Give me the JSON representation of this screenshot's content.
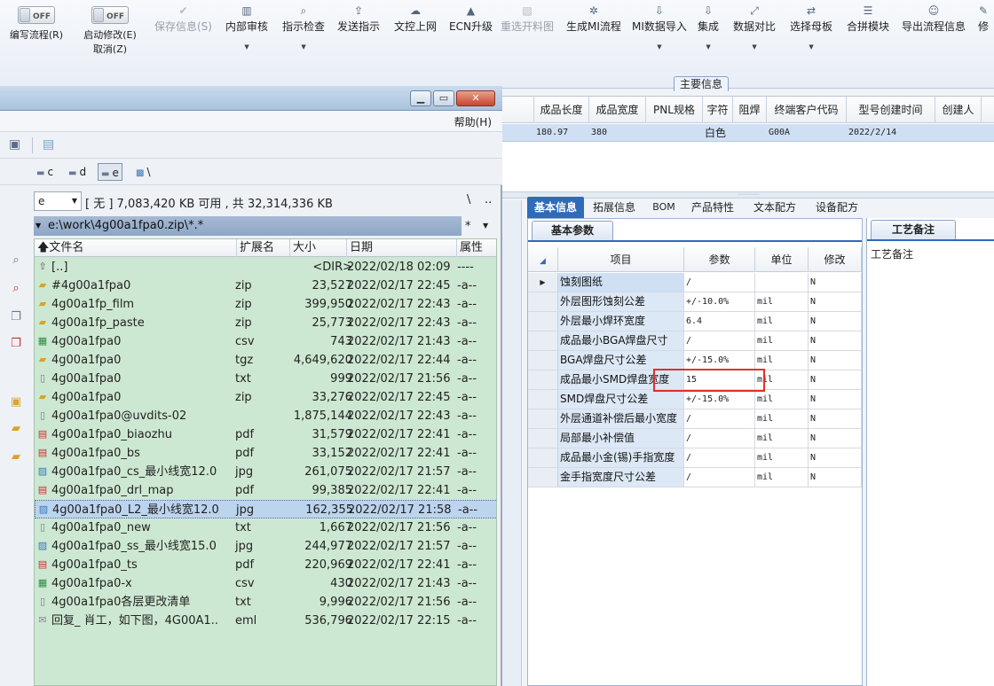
{
  "toolbar": {
    "toggle1": {
      "state": "OFF",
      "label": "编写流程(R)"
    },
    "toggle2": {
      "state": "OFF",
      "label1": "启动修改(E)",
      "label2": "取消(Z)"
    },
    "buttons": [
      {
        "label": "保存信息(S)",
        "icon": "check-icon",
        "disabled": true
      },
      {
        "label": "内部审核",
        "icon": "print-icon",
        "disabled": false,
        "dropdown": true
      },
      {
        "label": "指示检查",
        "icon": "search-icon",
        "disabled": false,
        "dropdown": true
      },
      {
        "label": "发送指示",
        "icon": "upload-icon",
        "disabled": false
      },
      {
        "label": "文控上网",
        "icon": "cloud-icon",
        "disabled": false
      },
      {
        "label": "ECN升级",
        "icon": "ecn-icon",
        "disabled": false
      },
      {
        "label": "重选开料图",
        "icon": "image-icon",
        "disabled": true
      },
      {
        "label": "生成MI流程",
        "icon": "gear-icon",
        "disabled": false
      },
      {
        "label": "MI数据导入",
        "icon": "download-icon",
        "disabled": false,
        "dropdown": true
      },
      {
        "label": "集成",
        "icon": "download-icon",
        "disabled": false,
        "dropdown": true
      },
      {
        "label": "数据对比",
        "icon": "compare-icon",
        "disabled": false,
        "dropdown": true
      },
      {
        "label": "选择母板",
        "icon": "shuffle-icon",
        "disabled": false,
        "dropdown": true
      },
      {
        "label": "合拼模块",
        "icon": "list-icon",
        "disabled": false
      },
      {
        "label": "导出流程信息",
        "icon": "smile-icon",
        "disabled": false
      },
      {
        "label": "修",
        "icon": "edit-icon",
        "disabled": false
      }
    ]
  },
  "main_info_tab": "主要信息",
  "top_grid": {
    "columns": [
      "成品长度",
      "成品宽度",
      "PNL规格",
      "字符",
      "阻焊",
      "终端客户代码",
      "型号创建时间",
      "创建人"
    ],
    "row": [
      "180.97",
      "380",
      "",
      "白色",
      "",
      "G00A",
      "2022/2/14",
      ""
    ]
  },
  "tabs": [
    "基本信息",
    "拓展信息",
    "BOM",
    "产品特性",
    "文本配方",
    "设备配方"
  ],
  "param_panel": {
    "tab": "基本参数",
    "columns": [
      "项目",
      "参数",
      "单位",
      "修改"
    ],
    "rows": [
      {
        "item": "蚀刻图纸",
        "param": "/",
        "unit": "",
        "mod": "N"
      },
      {
        "item": "外层图形蚀刻公差",
        "param": "+/-10.0%",
        "unit": "mil",
        "mod": "N"
      },
      {
        "item": "外层最小焊环宽度",
        "param": "6.4",
        "unit": "mil",
        "mod": "N"
      },
      {
        "item": "成品最小BGA焊盘尺寸",
        "param": "/",
        "unit": "mil",
        "mod": "N"
      },
      {
        "item": "BGA焊盘尺寸公差",
        "param": "+/-15.0%",
        "unit": "mil",
        "mod": "N"
      },
      {
        "item": "成品最小SMD焊盘宽度",
        "param": "15",
        "unit": "mil",
        "mod": "N"
      },
      {
        "item": "SMD焊盘尺寸公差",
        "param": "+/-15.0%",
        "unit": "mil",
        "mod": "N"
      },
      {
        "item": "外层通道补偿后最小宽度",
        "param": "/",
        "unit": "mil",
        "mod": "N"
      },
      {
        "item": "局部最小补偿值",
        "param": "/",
        "unit": "mil",
        "mod": "N"
      },
      {
        "item": "成品最小金(锡)手指宽度",
        "param": "/",
        "unit": "mil",
        "mod": "N"
      },
      {
        "item": "金手指宽度尺寸公差",
        "param": "/",
        "unit": "mil",
        "mod": "N"
      }
    ]
  },
  "notes_panel": {
    "tab": "工艺备注",
    "label": "工艺备注"
  },
  "file_manager": {
    "menu_help": "帮助(H)",
    "drives": [
      "c",
      "d",
      "e",
      "\\"
    ],
    "drive_select": "e",
    "free_space": "[ 无 ]  7,083,420 KB 可用 , 共 32,314,336 KB",
    "nav_back": "\\",
    "nav_up": "..",
    "path": "e:\\work\\4g00a1fpa0.zip\\*.*",
    "path_star": "*",
    "columns": {
      "name": "文件名",
      "ext": "扩展名",
      "size": "大小",
      "date": "日期",
      "attr": "属性"
    },
    "files": [
      {
        "icon": "up",
        "name": "[..]",
        "ext": "",
        "size": "<DIR>",
        "date": "2022/02/18 02:09",
        "attr": "----"
      },
      {
        "icon": "zip",
        "name": "#4g00a1fpa0",
        "ext": "zip",
        "size": "23,527",
        "date": "2022/02/17 22:45",
        "attr": "-a--"
      },
      {
        "icon": "zip",
        "name": "4g00a1fp_film",
        "ext": "zip",
        "size": "399,950",
        "date": "2022/02/17 22:43",
        "attr": "-a--"
      },
      {
        "icon": "zip",
        "name": "4g00a1fp_paste",
        "ext": "zip",
        "size": "25,773",
        "date": "2022/02/17 22:43",
        "attr": "-a--"
      },
      {
        "icon": "csv",
        "name": "4g00a1fpa0",
        "ext": "csv",
        "size": "743",
        "date": "2022/02/17 21:43",
        "attr": "-a--"
      },
      {
        "icon": "zip",
        "name": "4g00a1fpa0",
        "ext": "tgz",
        "size": "4,649,620",
        "date": "2022/02/17 22:44",
        "attr": "-a--"
      },
      {
        "icon": "txt",
        "name": "4g00a1fpa0",
        "ext": "txt",
        "size": "999",
        "date": "2022/02/17 21:56",
        "attr": "-a--"
      },
      {
        "icon": "zip",
        "name": "4g00a1fpa0",
        "ext": "zip",
        "size": "33,276",
        "date": "2022/02/17 22:45",
        "attr": "-a--"
      },
      {
        "icon": "txt",
        "name": "4g00a1fpa0@uvdits-02",
        "ext": "",
        "size": "1,875,144",
        "date": "2022/02/17 22:43",
        "attr": "-a--"
      },
      {
        "icon": "pdf",
        "name": "4g00a1fpa0_biaozhu",
        "ext": "pdf",
        "size": "31,579",
        "date": "2022/02/17 22:41",
        "attr": "-a--"
      },
      {
        "icon": "pdf",
        "name": "4g00a1fpa0_bs",
        "ext": "pdf",
        "size": "33,152",
        "date": "2022/02/17 22:41",
        "attr": "-a--"
      },
      {
        "icon": "img",
        "name": "4g00a1fpa0_cs_最小线宽12.0",
        "ext": "jpg",
        "size": "261,075",
        "date": "2022/02/17 21:57",
        "attr": "-a--"
      },
      {
        "icon": "pdf",
        "name": "4g00a1fpa0_drl_map",
        "ext": "pdf",
        "size": "99,385",
        "date": "2022/02/17 22:41",
        "attr": "-a--"
      },
      {
        "icon": "img",
        "name": "4g00a1fpa0_L2_最小线宽12.0",
        "ext": "jpg",
        "size": "162,355",
        "date": "2022/02/17 21:58",
        "attr": "-a--",
        "selected": true
      },
      {
        "icon": "txt",
        "name": "4g00a1fpa0_new",
        "ext": "txt",
        "size": "1,667",
        "date": "2022/02/17 21:56",
        "attr": "-a--"
      },
      {
        "icon": "img",
        "name": "4g00a1fpa0_ss_最小线宽15.0",
        "ext": "jpg",
        "size": "244,977",
        "date": "2022/02/17 21:57",
        "attr": "-a--"
      },
      {
        "icon": "pdf",
        "name": "4g00a1fpa0_ts",
        "ext": "pdf",
        "size": "220,969",
        "date": "2022/02/17 22:41",
        "attr": "-a--"
      },
      {
        "icon": "csv",
        "name": "4g00a1fpa0-x",
        "ext": "csv",
        "size": "430",
        "date": "2022/02/17 21:43",
        "attr": "-a--"
      },
      {
        "icon": "txt",
        "name": "4g00a1fpa0各层更改清单",
        "ext": "txt",
        "size": "9,996",
        "date": "2022/02/17 21:56",
        "attr": "-a--"
      },
      {
        "icon": "eml",
        "name": "回复_ 肖工，如下图，4G00A1..",
        "ext": "eml",
        "size": "536,796",
        "date": "2022/02/17 22:15",
        "attr": "-a--"
      }
    ]
  }
}
